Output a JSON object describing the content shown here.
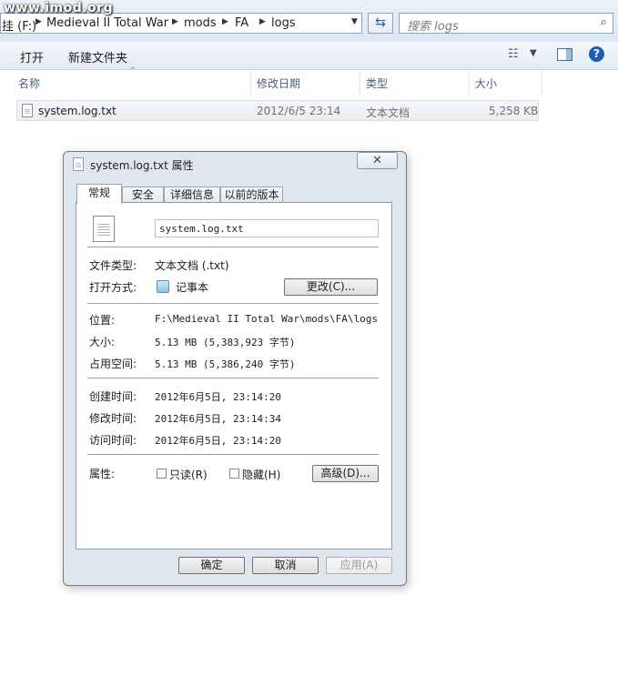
{
  "watermark": "www.imod.org",
  "address": {
    "drive": "挂 (F:)",
    "crumbs": [
      "Medieval II Total War",
      "mods",
      "FA",
      "logs"
    ]
  },
  "search": {
    "placeholder": "搜索 logs"
  },
  "toolbar": {
    "open": "打开",
    "new_folder": "新建文件夹"
  },
  "columns": {
    "name": "名称",
    "modified": "修改日期",
    "type": "类型",
    "size": "大小"
  },
  "file": {
    "name": "system.log.txt",
    "modified": "2012/6/5 23:14",
    "type": "文本文档",
    "size": "5,258 KB"
  },
  "dialog": {
    "title": "system.log.txt 属性",
    "close_glyph": "✕",
    "tabs": [
      "常规",
      "安全",
      "详细信息",
      "以前的版本"
    ],
    "filename": "system.log.txt",
    "file_type_label": "文件类型:",
    "file_type_value": "文本文档 (.txt)",
    "opens_with_label": "打开方式:",
    "opens_with_value": "记事本",
    "change_button": "更改(C)...",
    "location_label": "位置:",
    "location_value": "F:\\Medieval II Total War\\mods\\FA\\logs",
    "size_label": "大小:",
    "size_value": "5.13 MB (5,383,923 字节)",
    "disk_size_label": "占用空间:",
    "disk_size_value": "5.13 MB (5,386,240 字节)",
    "created_label": "创建时间:",
    "created_value": "2012年6月5日, 23:14:20",
    "modified_label": "修改时间:",
    "modified_value": "2012年6月5日, 23:14:34",
    "accessed_label": "访问时间:",
    "accessed_value": "2012年6月5日, 23:14:20",
    "attributes_label": "属性:",
    "readonly_label": "只读(R)",
    "hidden_label": "隐藏(H)",
    "advanced_button": "高级(D)...",
    "ok_button": "确定",
    "cancel_button": "取消",
    "apply_button": "应用(A)"
  }
}
